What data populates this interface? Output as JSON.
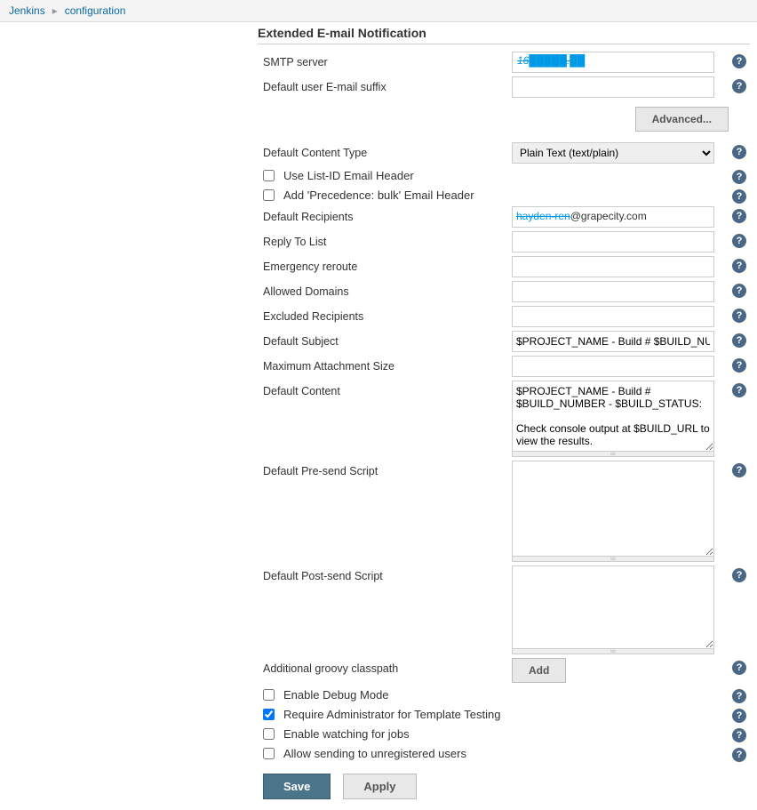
{
  "breadcrumb": {
    "root": "Jenkins",
    "page": "configuration"
  },
  "section_title": "Extended E-mail Notification",
  "fields": {
    "smtp_server": {
      "label": "SMTP server",
      "value": ""
    },
    "default_suffix": {
      "label": "Default user E-mail suffix",
      "value": ""
    },
    "advanced_btn": "Advanced...",
    "default_content_type": {
      "label": "Default Content Type",
      "value": "Plain Text (text/plain)"
    },
    "use_list_id": {
      "label": "Use List-ID Email Header",
      "checked": false
    },
    "add_precedence": {
      "label": "Add 'Precedence: bulk' Email Header",
      "checked": false
    },
    "default_recipients": {
      "label": "Default Recipients",
      "value_prefix": "hayden-ren",
      "value_suffix": "@grapecity.com"
    },
    "reply_to_list": {
      "label": "Reply To List",
      "value": ""
    },
    "emergency_reroute": {
      "label": "Emergency reroute",
      "value": ""
    },
    "allowed_domains": {
      "label": "Allowed Domains",
      "value": ""
    },
    "excluded_recipients": {
      "label": "Excluded Recipients",
      "value": ""
    },
    "default_subject": {
      "label": "Default Subject",
      "value": "$PROJECT_NAME - Build # $BUILD_NUMBER - $BUILD_STATUS!"
    },
    "max_attachment": {
      "label": "Maximum Attachment Size",
      "value": ""
    },
    "default_content": {
      "label": "Default Content",
      "value": "$PROJECT_NAME - Build # $BUILD_NUMBER - $BUILD_STATUS:\n\nCheck console output at $BUILD_URL to view the results."
    },
    "default_presend": {
      "label": "Default Pre-send Script",
      "value": ""
    },
    "default_postsend": {
      "label": "Default Post-send Script",
      "value": ""
    },
    "additional_classpath": {
      "label": "Additional groovy classpath",
      "add_btn": "Add"
    },
    "enable_debug": {
      "label": "Enable Debug Mode",
      "checked": false
    },
    "require_admin": {
      "label": "Require Administrator for Template Testing",
      "checked": true
    },
    "enable_watching": {
      "label": "Enable watching for jobs",
      "checked": false
    },
    "allow_unreg": {
      "label": "Allow sending to unregistered users",
      "checked": false
    }
  },
  "buttons": {
    "save": "Save",
    "apply": "Apply"
  }
}
